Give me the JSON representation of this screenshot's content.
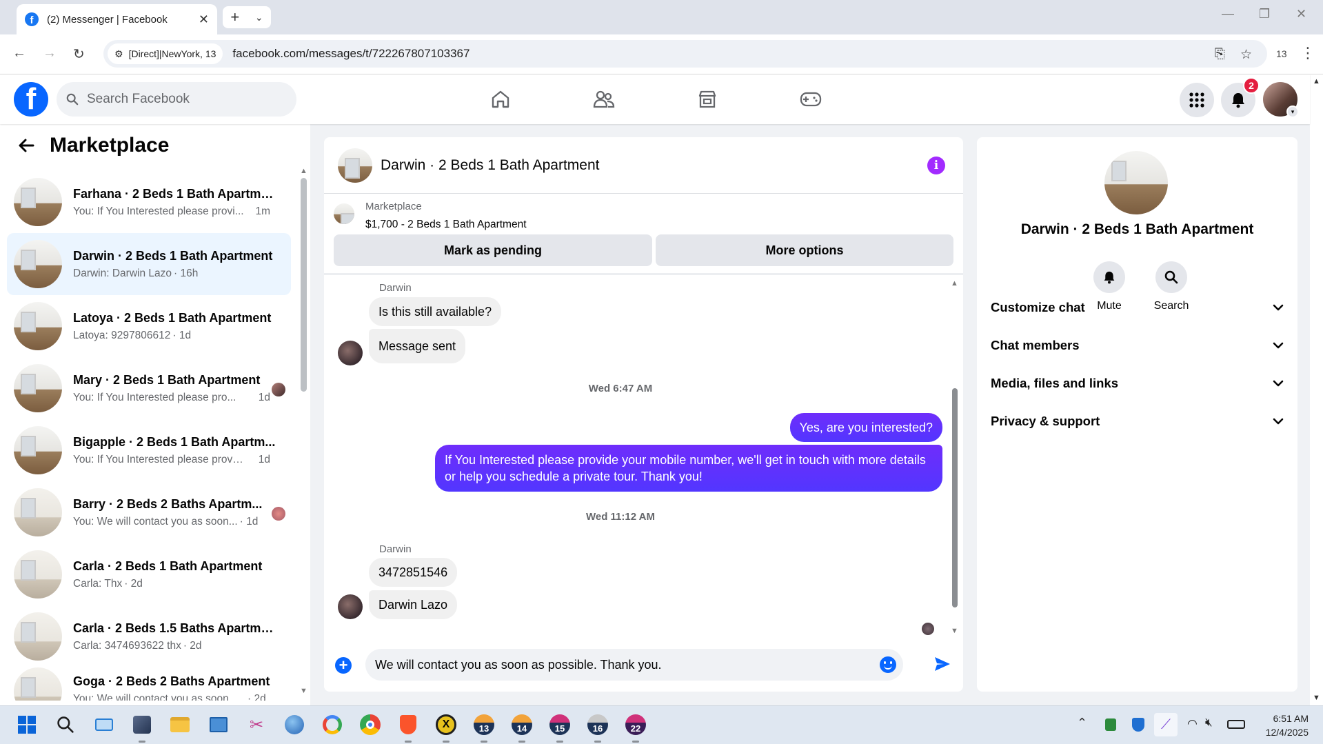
{
  "browser": {
    "tab_title": "(2) Messenger | Facebook",
    "site_chip": "[Direct]|NewYork, 13",
    "url": "facebook.com/messages/t/722267807103367",
    "profile_count": "13"
  },
  "fb": {
    "search_placeholder": "Search Facebook",
    "notification_count": "2"
  },
  "left_panel": {
    "title": "Marketplace",
    "conversations": [
      {
        "name": "Farhana · 2 Beds 1 Bath Apartme...",
        "preview": "You: If You Interested please provi...",
        "time": "1m"
      },
      {
        "name": "Darwin · 2 Beds 1 Bath Apartment",
        "preview": "Darwin: Darwin Lazo",
        "time": "· 16h"
      },
      {
        "name": "Latoya · 2 Beds 1 Bath Apartment",
        "preview": "Latoya: 9297806612",
        "time": "· 1d"
      },
      {
        "name": "Mary · 2 Beds 1 Bath Apartment",
        "preview": "You: If You Interested please pro...",
        "time": "1d"
      },
      {
        "name": "Bigapple · 2 Beds 1 Bath Apartm...",
        "preview": "You: If You Interested please provid...",
        "time": "1d"
      },
      {
        "name": "Barry · 2 Beds 2 Baths Apartm...",
        "preview": "You: We will contact you as soon...",
        "time": "· 1d"
      },
      {
        "name": "Carla · 2 Beds 1 Bath Apartment",
        "preview": "Carla: Thx",
        "time": "· 2d"
      },
      {
        "name": "Carla · 2 Beds 1.5 Baths Apartment",
        "preview": "Carla: 3474693622 thx",
        "time": "· 2d"
      },
      {
        "name": "Goga · 2 Beds 2 Baths Apartment",
        "preview": "You: We will contact you as soon as...",
        "time": "· 2d"
      }
    ]
  },
  "chat": {
    "title": "Darwin · 2 Beds 1 Bath Apartment",
    "marketplace_label": "Marketplace",
    "listing": "$1,700 - 2 Beds 1 Bath Apartment",
    "mark_pending": "Mark as pending",
    "more_options": "More options",
    "sender1": "Darwin",
    "msg1": "Is this still available?",
    "msg2": "Message sent",
    "timestamp1": "Wed 6:47 AM",
    "out1": "Yes, are you interested?",
    "out2": "If You Interested please provide your mobile number, we'll get in touch with more details or help you schedule a private tour. Thank you!",
    "timestamp2": "Wed 11:12 AM",
    "sender2": "Darwin",
    "msg3": "3472851546",
    "msg4": "Darwin Lazo",
    "composer_value": "We will contact you as soon as possible. Thank you."
  },
  "right_panel": {
    "name": "Darwin · 2 Beds 1 Bath Apartment",
    "mute": "Mute",
    "search": "Search",
    "sections": [
      "Customize chat",
      "Chat members",
      "Media, files and links",
      "Privacy & support"
    ]
  },
  "taskbar": {
    "time": "6:51 AM",
    "date": "12/4/2025",
    "badges": [
      "13",
      "14",
      "15",
      "16",
      "22"
    ]
  }
}
